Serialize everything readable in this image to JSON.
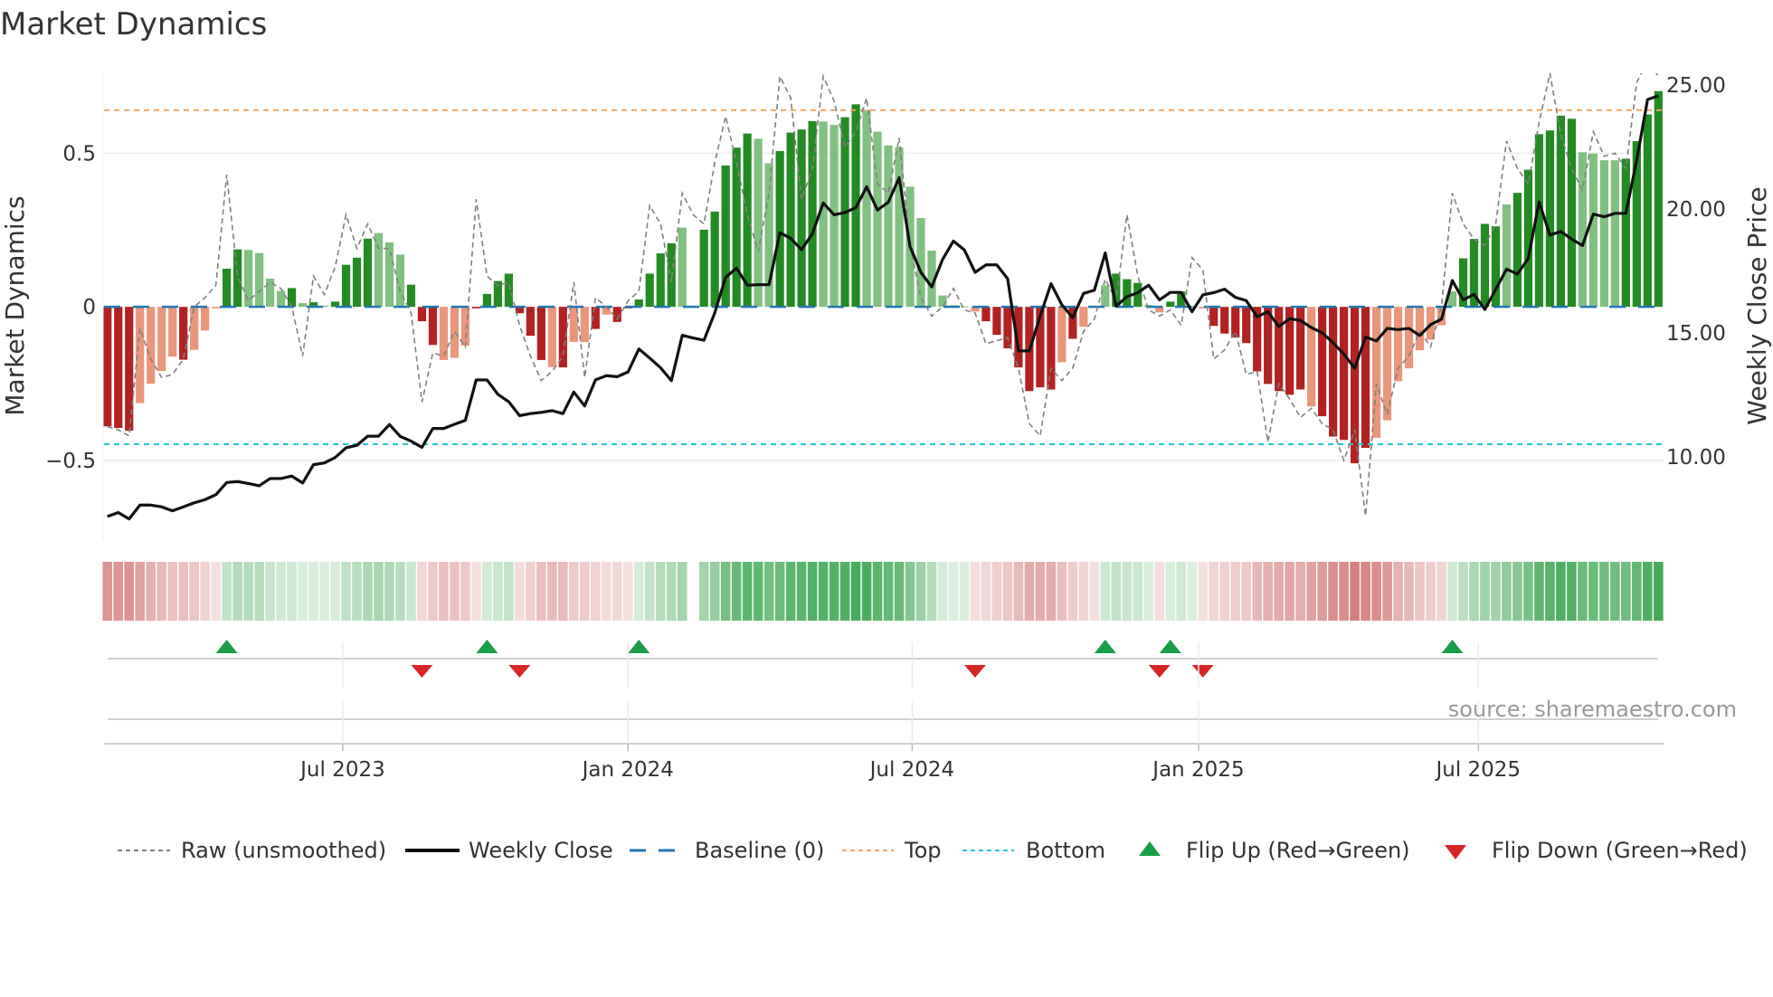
{
  "chart_data": {
    "type": "bar",
    "title": "Market Dynamics",
    "ylabel": "Market Dynamics",
    "y2label": "Weekly Close Price",
    "ylim": [
      -0.762,
      0.76
    ],
    "y2lim": [
      6.6,
      25.47
    ],
    "yticks": [
      {
        "v": 0.5,
        "label": "0.5"
      },
      {
        "v": 0,
        "label": "0"
      },
      {
        "v": -0.5,
        "label": "−0.5"
      }
    ],
    "y2ticks": [
      {
        "v": 25,
        "label": "25.00"
      },
      {
        "v": 20,
        "label": "20.00"
      },
      {
        "v": 15,
        "label": "15.00"
      },
      {
        "v": 10,
        "label": "10.00"
      }
    ],
    "xticks": [
      {
        "week": 21.7,
        "label": "Jul 2023"
      },
      {
        "week": 48,
        "label": "Jan 2024"
      },
      {
        "week": 74.2,
        "label": "Jul 2024"
      },
      {
        "week": 100.6,
        "label": "Jan 2025"
      },
      {
        "week": 126.4,
        "label": "Jul 2025"
      }
    ],
    "top_level": 0.64,
    "bottom_level": -0.447,
    "baseline": 0,
    "dynamics": [
      -0.389,
      -0.394,
      -0.403,
      -0.313,
      -0.25,
      -0.209,
      -0.162,
      -0.172,
      -0.14,
      -0.077,
      -0.005,
      0.124,
      0.187,
      0.185,
      0.175,
      0.092,
      0.052,
      0.061,
      0.012,
      0.015,
      0.004,
      0.017,
      0.137,
      0.16,
      0.222,
      0.24,
      0.21,
      0.17,
      0.072,
      -0.047,
      -0.124,
      -0.173,
      -0.166,
      -0.126,
      -0.005,
      0.042,
      0.084,
      0.108,
      -0.021,
      -0.094,
      -0.173,
      -0.196,
      -0.197,
      -0.114,
      -0.115,
      -0.072,
      -0.025,
      -0.049,
      -0.005,
      0.024,
      0.108,
      0.174,
      0.207,
      0.258,
      null,
      0.251,
      0.31,
      0.46,
      0.518,
      0.564,
      0.547,
      0.467,
      0.507,
      0.567,
      0.577,
      0.604,
      0.603,
      0.592,
      0.617,
      0.659,
      0.639,
      0.57,
      0.525,
      0.519,
      0.391,
      0.289,
      0.183,
      0.037,
      0.005,
      0.002,
      -0.015,
      -0.047,
      -0.091,
      -0.135,
      -0.197,
      -0.274,
      -0.262,
      -0.269,
      -0.18,
      -0.104,
      -0.065,
      -0.003,
      0.07,
      0.108,
      0.09,
      0.078,
      0.006,
      -0.018,
      0.017,
      0.05,
      0.002,
      -0.005,
      -0.062,
      -0.087,
      -0.1,
      -0.118,
      -0.21,
      -0.251,
      -0.274,
      -0.286,
      -0.269,
      -0.324,
      -0.356,
      -0.422,
      -0.433,
      -0.509,
      -0.459,
      -0.426,
      -0.369,
      -0.242,
      -0.2,
      -0.141,
      -0.107,
      -0.06,
      0.05,
      0.158,
      0.221,
      0.27,
      0.262,
      0.333,
      0.371,
      0.446,
      0.562,
      0.574,
      0.622,
      0.612,
      0.503,
      0.499,
      0.477,
      0.477,
      0.482,
      0.539,
      0.626,
      0.702
    ],
    "shade": "dddlllldlllddlllldldlddddllldddllldddddddldlldldddddd-ldddddllddddlldd lllllllllldddddddldllldddlldddldddddddddldddddllllllllddddlddddddllllddddd",
    "raw": [
      -0.39,
      -0.4,
      -0.42,
      -0.07,
      -0.17,
      -0.23,
      -0.22,
      -0.17,
      0.0,
      0.03,
      0.07,
      0.43,
      0.1,
      0.02,
      0.05,
      0.08,
      0.06,
      0.0,
      -0.16,
      0.1,
      0.04,
      0.13,
      0.3,
      0.19,
      0.27,
      0.19,
      0.19,
      0.05,
      -0.02,
      -0.31,
      -0.15,
      -0.16,
      -0.08,
      -0.13,
      0.35,
      0.1,
      0.07,
      0.08,
      -0.06,
      -0.16,
      -0.24,
      -0.21,
      -0.16,
      0.08,
      -0.23,
      0.03,
      0.0,
      -0.04,
      0.02,
      0.05,
      0.33,
      0.27,
      0.08,
      0.37,
      0.3,
      0.27,
      0.47,
      0.62,
      0.47,
      0.3,
      0.18,
      0.37,
      0.75,
      0.68,
      0.35,
      0.45,
      0.75,
      0.67,
      0.52,
      0.57,
      0.68,
      0.4,
      0.37,
      0.55,
      0.2,
      0.03,
      -0.03,
      0.0,
      0.06,
      -0.01,
      -0.02,
      -0.12,
      -0.11,
      -0.1,
      -0.2,
      -0.38,
      -0.42,
      -0.2,
      -0.24,
      -0.2,
      -0.08,
      -0.04,
      0.09,
      0.02,
      0.3,
      0.1,
      -0.01,
      -0.03,
      -0.01,
      -0.06,
      0.16,
      0.12,
      -0.17,
      -0.14,
      -0.08,
      -0.22,
      -0.21,
      -0.44,
      -0.25,
      -0.3,
      -0.36,
      -0.33,
      -0.38,
      -0.4,
      -0.5,
      -0.4,
      -0.68,
      -0.25,
      -0.35,
      -0.2,
      -0.16,
      -0.08,
      -0.13,
      0.0,
      0.37,
      0.27,
      0.22,
      0.2,
      0.27,
      0.54,
      0.45,
      0.4,
      0.6,
      0.76,
      0.56,
      0.45,
      0.38,
      0.57,
      0.49,
      0.5,
      0.45,
      0.73,
      0.8,
      0.75
    ],
    "close": [
      7.59,
      7.75,
      7.49,
      8.05,
      8.05,
      7.98,
      7.82,
      7.98,
      8.14,
      8.27,
      8.47,
      8.96,
      9.0,
      8.92,
      8.83,
      9.12,
      9.12,
      9.22,
      8.94,
      9.68,
      9.75,
      9.97,
      10.36,
      10.46,
      10.83,
      10.83,
      11.3,
      10.82,
      10.63,
      10.38,
      11.14,
      11.14,
      11.31,
      11.47,
      13.1,
      13.1,
      12.52,
      12.22,
      11.66,
      11.74,
      11.79,
      11.86,
      11.74,
      12.61,
      12.05,
      13.1,
      13.27,
      13.23,
      13.42,
      14.35,
      13.98,
      13.59,
      13.07,
      14.9,
      14.79,
      14.7,
      15.81,
      17.24,
      17.61,
      16.92,
      16.94,
      16.94,
      19.04,
      18.81,
      18.35,
      19.0,
      20.24,
      19.76,
      19.85,
      20.05,
      20.89,
      19.95,
      20.27,
      21.26,
      18.48,
      17.44,
      16.85,
      17.96,
      18.7,
      18.35,
      17.44,
      17.74,
      17.74,
      17.18,
      14.27,
      14.27,
      15.68,
      16.98,
      16.13,
      15.61,
      16.59,
      16.72,
      18.22,
      16.07,
      16.46,
      16.62,
      16.92,
      16.33,
      16.63,
      16.63,
      15.85,
      16.53,
      16.62,
      16.76,
      16.43,
      16.3,
      15.65,
      15.85,
      15.25,
      15.57,
      15.5,
      15.21,
      15.0,
      14.6,
      14.14,
      13.57,
      14.83,
      14.67,
      15.18,
      15.13,
      15.18,
      14.89,
      15.33,
      15.55,
      17.11,
      16.33,
      16.55,
      15.94,
      16.75,
      17.57,
      17.37,
      18.0,
      20.28,
      18.94,
      19.09,
      18.78,
      18.52,
      19.79,
      19.68,
      19.82,
      19.82,
      21.97,
      24.41,
      24.56
    ],
    "flip_up_weeks": [
      11,
      35,
      49,
      92,
      98,
      124
    ],
    "flip_down_weeks": [
      29,
      38,
      80,
      97,
      101
    ],
    "legend": {
      "position": "bottom",
      "items": [
        {
          "key": "raw",
          "label": "Raw (unsmoothed)"
        },
        {
          "key": "close",
          "label": "Weekly Close"
        },
        {
          "key": "baseline",
          "label": "Baseline (0)"
        },
        {
          "key": "top",
          "label": "Top"
        },
        {
          "key": "bottom",
          "label": "Bottom"
        },
        {
          "key": "up",
          "label": "Flip Up (Red→Green)"
        },
        {
          "key": "down",
          "label": "Flip Down (Green→Red)"
        }
      ]
    },
    "source": "source: sharemaestro.com"
  },
  "colors": {
    "dark_green": "#228b22",
    "light_green": "#80c080",
    "dark_red": "#b22222",
    "light_red": "#e9967a",
    "raw": "#808080",
    "close": "#111111",
    "baseline": "#1f77b4",
    "top": "#f4a460",
    "bottom": "#22c7d6",
    "flip_up": "#1a9e4a",
    "flip_down": "#d62728"
  }
}
